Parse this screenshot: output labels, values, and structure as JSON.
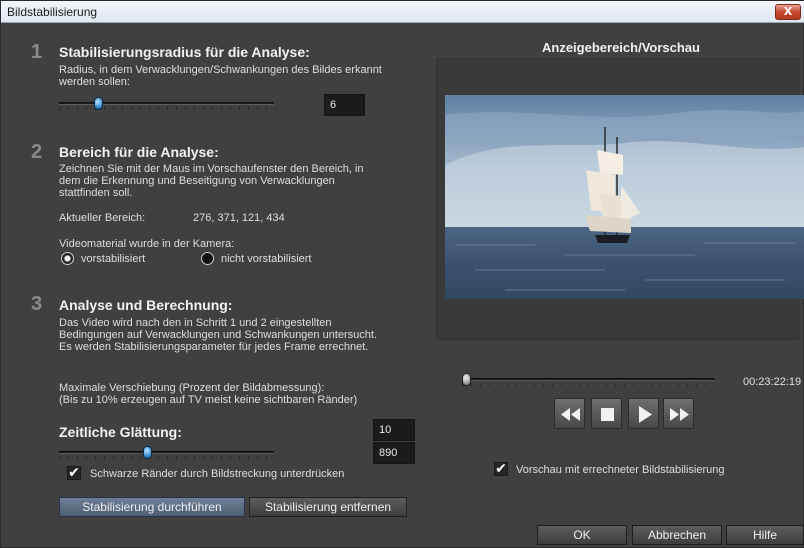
{
  "window": {
    "title": "Bildstabilisierung",
    "close_glyph": "X"
  },
  "section1": {
    "number": "1",
    "heading": "Stabilisierungsradius für die Analyse:",
    "desc_line1": "Radius, in dem Verwacklungen/Schwankungen des Bildes erkannt",
    "desc_line2": "werden sollen:",
    "slider_fraction": 0.17,
    "value": "6"
  },
  "section2": {
    "number": "2",
    "heading": "Bereich für die Analyse:",
    "desc_line1": "Zeichnen Sie mit der Maus im Vorschaufenster den Bereich, in",
    "desc_line2": "dem die Erkennung und Beseitigung von Verwacklungen",
    "desc_line3": "stattfinden soll.",
    "current_area_label": "Aktueller Bereich:",
    "current_area_value": "276, 371, 121, 434",
    "camera_label": "Videomaterial wurde in der Kamera:",
    "option_stabilized": "vorstabilisiert",
    "option_not_stabilized": "nicht vorstabilisiert",
    "selected_option": "vorstabilisiert"
  },
  "section3": {
    "number": "3",
    "heading": "Analyse und Berechnung:",
    "desc_line1": "Das Video wird nach den in Schritt 1 und 2 eingestellten",
    "desc_line2": "Bedingungen auf Verwacklungen und Schwankungen untersucht.",
    "desc_line3": "Es werden Stabilisierungsparameter für jedes Frame errechnet.",
    "max_shift_line1": "Maximale Verschiebung (Prozent der Bildabmessung):",
    "max_shift_line2": "(Bis zu 10% erzeugen auf TV meist keine sichtbaren Ränder)",
    "max_shift_value": "10",
    "smoothing_heading": "Zeitliche Glättung:",
    "smoothing_slider_fraction": 0.41,
    "smoothing_value": "890",
    "black_borders_label": "Schwarze Ränder durch Bildstreckung unterdrücken",
    "black_borders_checked": true,
    "run_button": "Stabilisierung durchführen",
    "remove_button": "Stabilisierung entfernen"
  },
  "preview": {
    "heading": "Anzeigebereich/Vorschau",
    "timeline_fraction": 0.0,
    "timecode": "00:23:22:19",
    "checkbox_label": "Vorschau mit errechneter Bildstabilisierung",
    "checkbox_checked": true,
    "transport_icons": [
      "rewind-icon",
      "stop-icon",
      "play-icon",
      "fast-forward-icon"
    ]
  },
  "footer": {
    "ok": "OK",
    "cancel": "Abbrechen",
    "help": "Hilfe"
  },
  "colors": {
    "accent": "#3d8fd1",
    "background": "#404040"
  }
}
